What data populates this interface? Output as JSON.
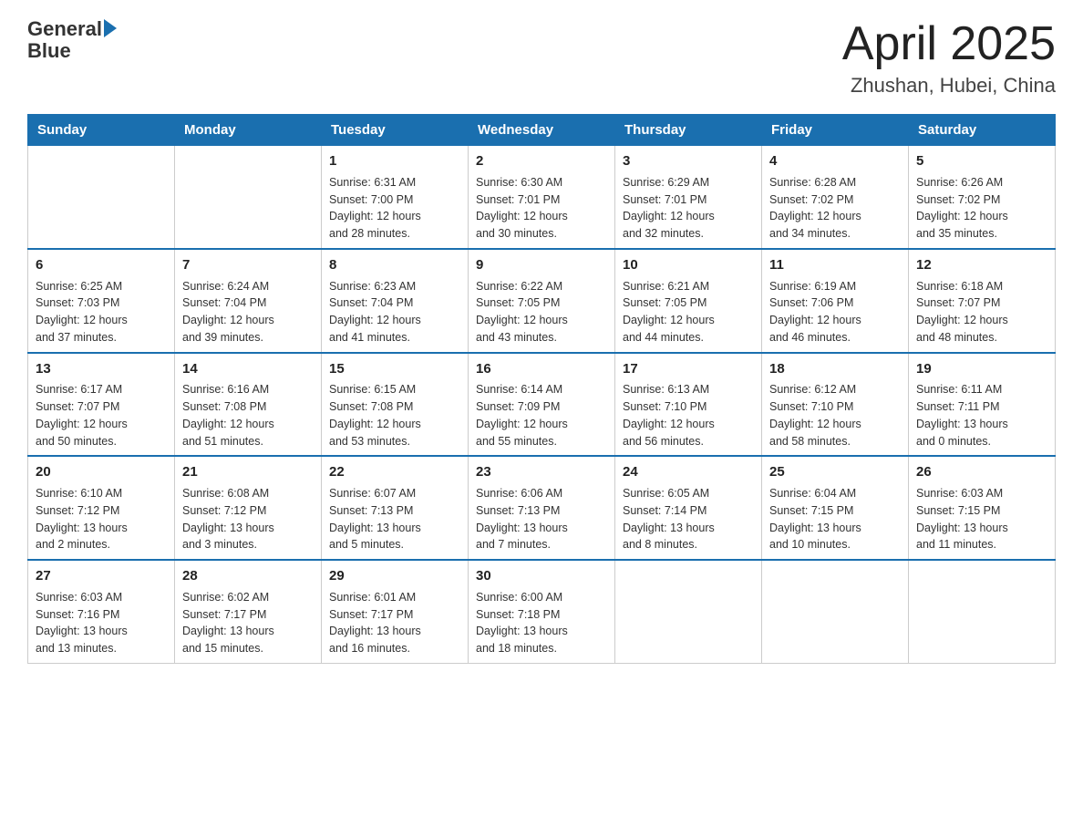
{
  "header": {
    "logo_text_general": "General",
    "logo_text_blue": "Blue",
    "month_year": "April 2025",
    "location": "Zhushan, Hubei, China"
  },
  "days_of_week": [
    "Sunday",
    "Monday",
    "Tuesday",
    "Wednesday",
    "Thursday",
    "Friday",
    "Saturday"
  ],
  "weeks": [
    [
      {
        "day": "",
        "info": ""
      },
      {
        "day": "",
        "info": ""
      },
      {
        "day": "1",
        "info": "Sunrise: 6:31 AM\nSunset: 7:00 PM\nDaylight: 12 hours\nand 28 minutes."
      },
      {
        "day": "2",
        "info": "Sunrise: 6:30 AM\nSunset: 7:01 PM\nDaylight: 12 hours\nand 30 minutes."
      },
      {
        "day": "3",
        "info": "Sunrise: 6:29 AM\nSunset: 7:01 PM\nDaylight: 12 hours\nand 32 minutes."
      },
      {
        "day": "4",
        "info": "Sunrise: 6:28 AM\nSunset: 7:02 PM\nDaylight: 12 hours\nand 34 minutes."
      },
      {
        "day": "5",
        "info": "Sunrise: 6:26 AM\nSunset: 7:02 PM\nDaylight: 12 hours\nand 35 minutes."
      }
    ],
    [
      {
        "day": "6",
        "info": "Sunrise: 6:25 AM\nSunset: 7:03 PM\nDaylight: 12 hours\nand 37 minutes."
      },
      {
        "day": "7",
        "info": "Sunrise: 6:24 AM\nSunset: 7:04 PM\nDaylight: 12 hours\nand 39 minutes."
      },
      {
        "day": "8",
        "info": "Sunrise: 6:23 AM\nSunset: 7:04 PM\nDaylight: 12 hours\nand 41 minutes."
      },
      {
        "day": "9",
        "info": "Sunrise: 6:22 AM\nSunset: 7:05 PM\nDaylight: 12 hours\nand 43 minutes."
      },
      {
        "day": "10",
        "info": "Sunrise: 6:21 AM\nSunset: 7:05 PM\nDaylight: 12 hours\nand 44 minutes."
      },
      {
        "day": "11",
        "info": "Sunrise: 6:19 AM\nSunset: 7:06 PM\nDaylight: 12 hours\nand 46 minutes."
      },
      {
        "day": "12",
        "info": "Sunrise: 6:18 AM\nSunset: 7:07 PM\nDaylight: 12 hours\nand 48 minutes."
      }
    ],
    [
      {
        "day": "13",
        "info": "Sunrise: 6:17 AM\nSunset: 7:07 PM\nDaylight: 12 hours\nand 50 minutes."
      },
      {
        "day": "14",
        "info": "Sunrise: 6:16 AM\nSunset: 7:08 PM\nDaylight: 12 hours\nand 51 minutes."
      },
      {
        "day": "15",
        "info": "Sunrise: 6:15 AM\nSunset: 7:08 PM\nDaylight: 12 hours\nand 53 minutes."
      },
      {
        "day": "16",
        "info": "Sunrise: 6:14 AM\nSunset: 7:09 PM\nDaylight: 12 hours\nand 55 minutes."
      },
      {
        "day": "17",
        "info": "Sunrise: 6:13 AM\nSunset: 7:10 PM\nDaylight: 12 hours\nand 56 minutes."
      },
      {
        "day": "18",
        "info": "Sunrise: 6:12 AM\nSunset: 7:10 PM\nDaylight: 12 hours\nand 58 minutes."
      },
      {
        "day": "19",
        "info": "Sunrise: 6:11 AM\nSunset: 7:11 PM\nDaylight: 13 hours\nand 0 minutes."
      }
    ],
    [
      {
        "day": "20",
        "info": "Sunrise: 6:10 AM\nSunset: 7:12 PM\nDaylight: 13 hours\nand 2 minutes."
      },
      {
        "day": "21",
        "info": "Sunrise: 6:08 AM\nSunset: 7:12 PM\nDaylight: 13 hours\nand 3 minutes."
      },
      {
        "day": "22",
        "info": "Sunrise: 6:07 AM\nSunset: 7:13 PM\nDaylight: 13 hours\nand 5 minutes."
      },
      {
        "day": "23",
        "info": "Sunrise: 6:06 AM\nSunset: 7:13 PM\nDaylight: 13 hours\nand 7 minutes."
      },
      {
        "day": "24",
        "info": "Sunrise: 6:05 AM\nSunset: 7:14 PM\nDaylight: 13 hours\nand 8 minutes."
      },
      {
        "day": "25",
        "info": "Sunrise: 6:04 AM\nSunset: 7:15 PM\nDaylight: 13 hours\nand 10 minutes."
      },
      {
        "day": "26",
        "info": "Sunrise: 6:03 AM\nSunset: 7:15 PM\nDaylight: 13 hours\nand 11 minutes."
      }
    ],
    [
      {
        "day": "27",
        "info": "Sunrise: 6:03 AM\nSunset: 7:16 PM\nDaylight: 13 hours\nand 13 minutes."
      },
      {
        "day": "28",
        "info": "Sunrise: 6:02 AM\nSunset: 7:17 PM\nDaylight: 13 hours\nand 15 minutes."
      },
      {
        "day": "29",
        "info": "Sunrise: 6:01 AM\nSunset: 7:17 PM\nDaylight: 13 hours\nand 16 minutes."
      },
      {
        "day": "30",
        "info": "Sunrise: 6:00 AM\nSunset: 7:18 PM\nDaylight: 13 hours\nand 18 minutes."
      },
      {
        "day": "",
        "info": ""
      },
      {
        "day": "",
        "info": ""
      },
      {
        "day": "",
        "info": ""
      }
    ]
  ]
}
